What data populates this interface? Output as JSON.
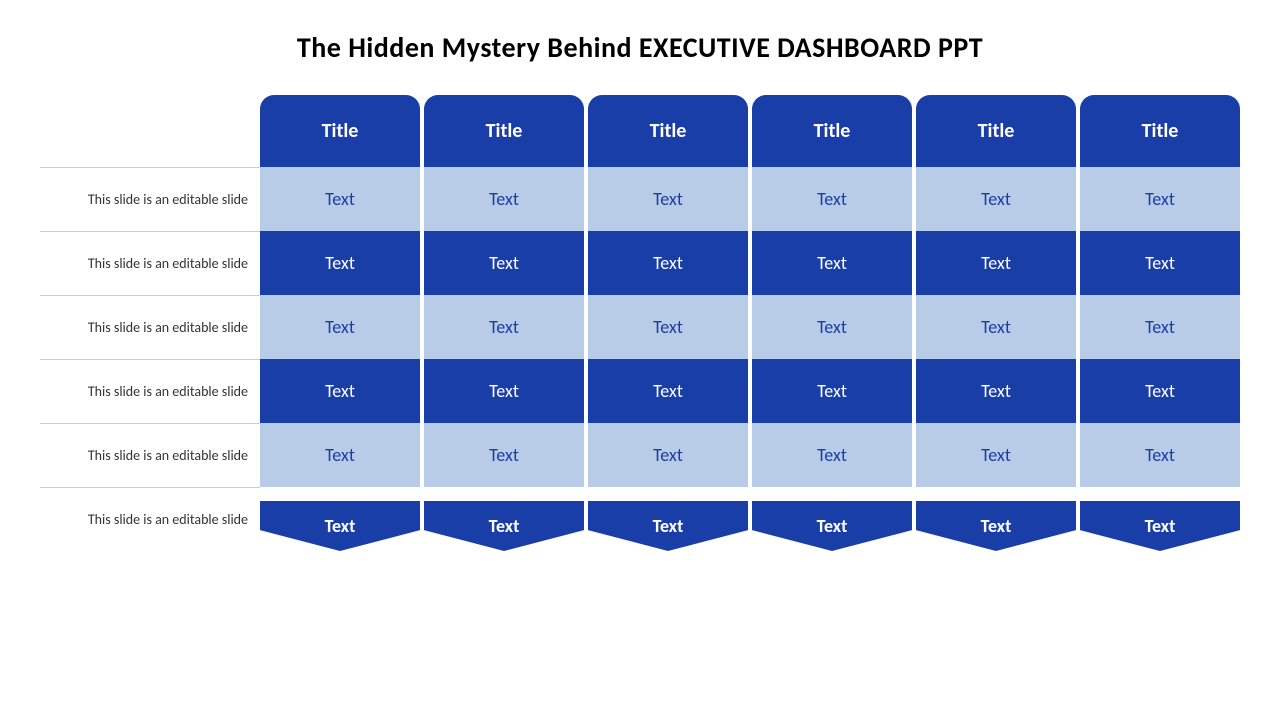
{
  "title": "The Hidden Mystery Behind EXECUTIVE DASHBOARD PPT",
  "left_labels": {
    "spacer": "",
    "rows": [
      "This slide is an editable slide",
      "This slide is an editable slide",
      "This slide is an editable slide",
      "This slide is an editable slide",
      "This slide is an editable slide",
      "This slide is an editable slide"
    ]
  },
  "header": {
    "cells": [
      "Title",
      "Title",
      "Title",
      "Title",
      "Title",
      "Title"
    ]
  },
  "rows": [
    {
      "type": "light",
      "cells": [
        "Text",
        "Text",
        "Text",
        "Text",
        "Text",
        "Text"
      ]
    },
    {
      "type": "dark",
      "cells": [
        "Text",
        "Text",
        "Text",
        "Text",
        "Text",
        "Text"
      ]
    },
    {
      "type": "light",
      "cells": [
        "Text",
        "Text",
        "Text",
        "Text",
        "Text",
        "Text"
      ]
    },
    {
      "type": "dark",
      "cells": [
        "Text",
        "Text",
        "Text",
        "Text",
        "Text",
        "Text"
      ]
    },
    {
      "type": "light",
      "cells": [
        "Text",
        "Text",
        "Text",
        "Text",
        "Text",
        "Text"
      ]
    }
  ],
  "arrow_row": {
    "cells": [
      "Text",
      "Text",
      "Text",
      "Text",
      "Text",
      "Text"
    ],
    "color_dark": "#1a3ea8",
    "color_light": "#b8cce8"
  },
  "colors": {
    "dark_blue": "#1a3ea8",
    "light_blue": "#b8cce8",
    "arrow_dark": "#142d7a"
  }
}
